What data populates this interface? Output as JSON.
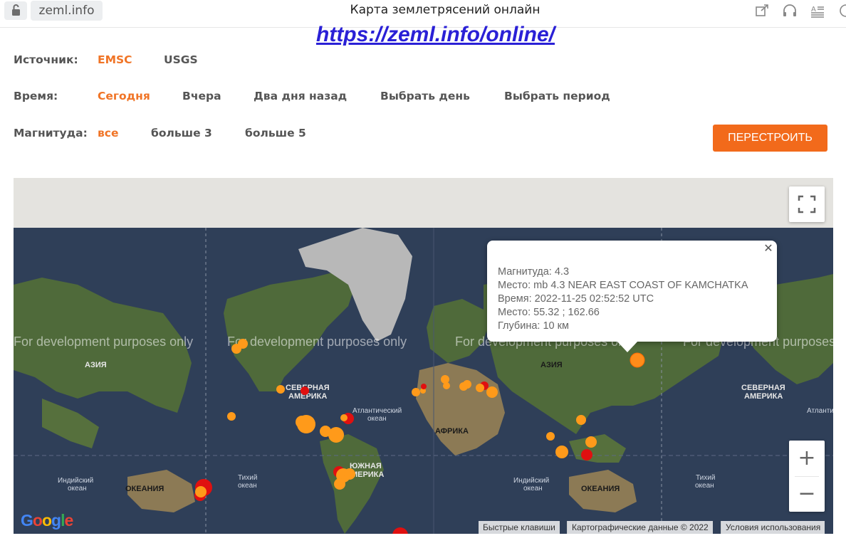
{
  "browser": {
    "site": "zeml.info",
    "tab_title": "Карта землетрясений онлайн"
  },
  "page_link": "https://zeml.info/online/",
  "filters": {
    "source": {
      "label": "Источник:",
      "options": [
        "EMSC",
        "USGS"
      ],
      "selected": "EMSC"
    },
    "time": {
      "label": "Время:",
      "options": [
        "Сегодня",
        "Вчера",
        "Два дня назад",
        "Выбрать день",
        "Выбрать период"
      ],
      "selected": "Сегодня"
    },
    "magnitude": {
      "label": "Магнитуда:",
      "options": [
        "все",
        "больше 3",
        "больше 5"
      ],
      "selected": "все"
    }
  },
  "rebuild_button": "ПЕРЕСТРОИТЬ",
  "map": {
    "watermarks": [
      "For development purposes only",
      "For development purposes only",
      "For development purposes only",
      "For development purposes"
    ],
    "labels": {
      "asia": "АЗИЯ",
      "north_america_1": "СЕВЕРНАЯ",
      "north_america_2": "АМЕРИКА",
      "atlantic_1": "Атлантический",
      "atlantic_2": "океан",
      "africa": "АФРИКА",
      "south_america_1": "ЮЖНАЯ",
      "south_america_2": "АМЕРИКА",
      "pacific_1": "Тихий",
      "pacific_2": "океан",
      "indian_1": "Индийский",
      "indian_2": "океан",
      "oceania": "ОКЕАНИЯ",
      "atlantic_short": "Атлантиче",
      "pacific_short": "Тихий"
    },
    "attribution": [
      "Быстрые клавиши",
      "Картографические данные © 2022",
      "Условия использования"
    ],
    "google_logo": "Google",
    "zoom_in": "+",
    "zoom_out": "−",
    "colors": {
      "ocean": "#2f3f58",
      "land": "#4f6a3a",
      "desert": "#8c7a55",
      "ice": "#b8b8b8",
      "quake_orange": "#ff9a1a",
      "quake_red": "#e01010"
    }
  },
  "infowindow": {
    "lines": [
      "Магнитуда: 4.3",
      "Место: mb 4.3 NEAR EAST COAST OF KAMCHATKA",
      "Время: 2022-11-25 02:52:52 UTC",
      "Место: 55.32 ; 162.66",
      "Глубина: 10 км"
    ]
  }
}
